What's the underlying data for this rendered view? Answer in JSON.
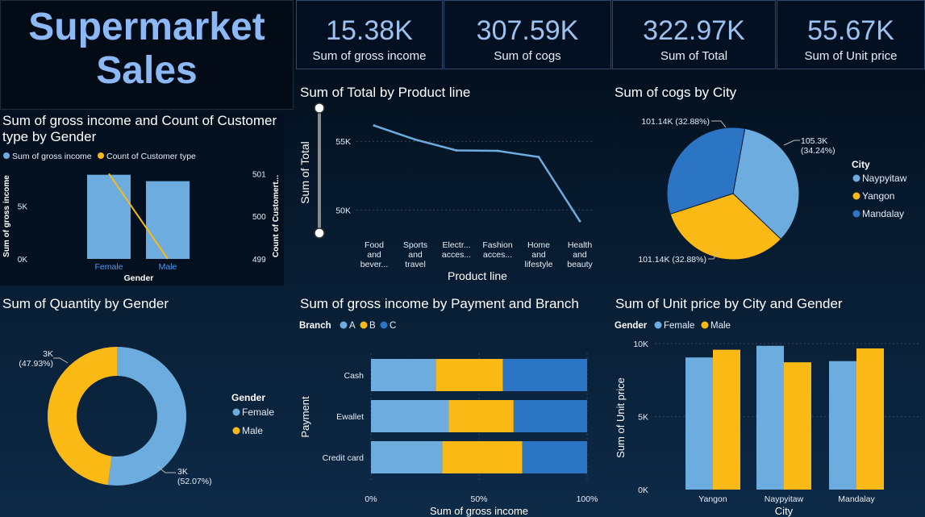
{
  "title": "Supermarket Sales",
  "kpis": [
    {
      "value": "15.38K",
      "label": "Sum of gross income"
    },
    {
      "value": "307.59K",
      "label": "Sum of cogs"
    },
    {
      "value": "322.97K",
      "label": "Sum of Total"
    },
    {
      "value": "55.67K",
      "label": "Sum of Unit price"
    }
  ],
  "colors": {
    "light_blue": "#6cacde",
    "yellow": "#fbb916",
    "dark_blue": "#2c74c4",
    "title": "#8cb8f5"
  },
  "chart_data": [
    {
      "id": "gender-combo",
      "type": "bar",
      "title": "Sum of gross income and Count of Customer type by Gender",
      "categories": [
        "Female",
        "Male"
      ],
      "series": [
        {
          "name": "Sum of gross income",
          "type": "bar",
          "values": [
            7990,
            7380
          ]
        },
        {
          "name": "Count of Customer type",
          "type": "line",
          "axis": "right",
          "values": [
            501,
            499
          ]
        }
      ],
      "xlabel": "Gender",
      "ylabel": "Sum of gross income",
      "y2label": "Count of Customert...",
      "yticks": [
        "0K",
        "5K"
      ],
      "y2ticks": [
        "499",
        "500",
        "501"
      ],
      "ylim": [
        0,
        8500
      ],
      "y2lim": [
        499,
        501.1
      ]
    },
    {
      "id": "total-by-product",
      "type": "line",
      "title": "Sum of Total by Product line",
      "categories": [
        [
          "Food",
          "and",
          "bever..."
        ],
        [
          "Sports",
          "and",
          "travel"
        ],
        [
          "Electr...",
          "acces..."
        ],
        [
          "Fashion",
          "acces..."
        ],
        [
          "Home",
          "and",
          "lifestyle"
        ],
        [
          "Health",
          "and",
          "beauty"
        ]
      ],
      "values": [
        56145,
        55123,
        54338,
        54306,
        53862,
        49194
      ],
      "xlabel": "Product line",
      "ylabel": "Sum of Total",
      "yticks": [
        "50K",
        "55K"
      ],
      "ylim": [
        48500,
        57300
      ]
    },
    {
      "id": "cogs-by-city",
      "type": "pie",
      "title": "Sum of cogs by City",
      "legend_title": "City",
      "slices": [
        {
          "name": "Naypyitaw",
          "value": 105.3,
          "label": "105.3K",
          "pct": "(34.24%)"
        },
        {
          "name": "Yangon",
          "value": 101.14,
          "label": "101.14K (32.88%)"
        },
        {
          "name": "Mandalay",
          "value": 101.14,
          "label": "101.14K (32.88%)"
        }
      ]
    },
    {
      "id": "qty-by-gender",
      "type": "pie",
      "title": "Sum of Quantity by Gender",
      "legend_title": "Gender",
      "slices": [
        {
          "name": "Female",
          "value": 52.07,
          "label": "3K",
          "pct": "(52.07%)"
        },
        {
          "name": "Male",
          "value": 47.93,
          "label": "3K",
          "pct": "(47.93%)"
        }
      ]
    },
    {
      "id": "gross-by-payment",
      "type": "bar",
      "title": "Sum of gross income by Payment and Branch",
      "legend_title": "Branch",
      "categories": [
        "Cash",
        "Ewallet",
        "Credit card"
      ],
      "series": [
        {
          "name": "A",
          "values": [
            30,
            36,
            33
          ]
        },
        {
          "name": "B",
          "values": [
            31,
            30,
            37
          ]
        },
        {
          "name": "C",
          "values": [
            39,
            34,
            30
          ]
        }
      ],
      "xlabel": "Sum of gross income",
      "ylabel": "Payment",
      "xticks": [
        "0%",
        "50%",
        "100%"
      ]
    },
    {
      "id": "unit-price-by-city",
      "type": "bar",
      "title": "Sum of Unit price by City and Gender",
      "legend_title": "Gender",
      "categories": [
        "Yangon",
        "Naypyitaw",
        "Mandalay"
      ],
      "series": [
        {
          "name": "Female",
          "values": [
            9050,
            9850,
            8800
          ]
        },
        {
          "name": "Male",
          "values": [
            9580,
            8720,
            9670
          ]
        }
      ],
      "xlabel": "City",
      "ylabel": "Sum of Unit price",
      "yticks": [
        "0K",
        "5K",
        "10K"
      ],
      "ylim": [
        0,
        10000
      ]
    }
  ]
}
